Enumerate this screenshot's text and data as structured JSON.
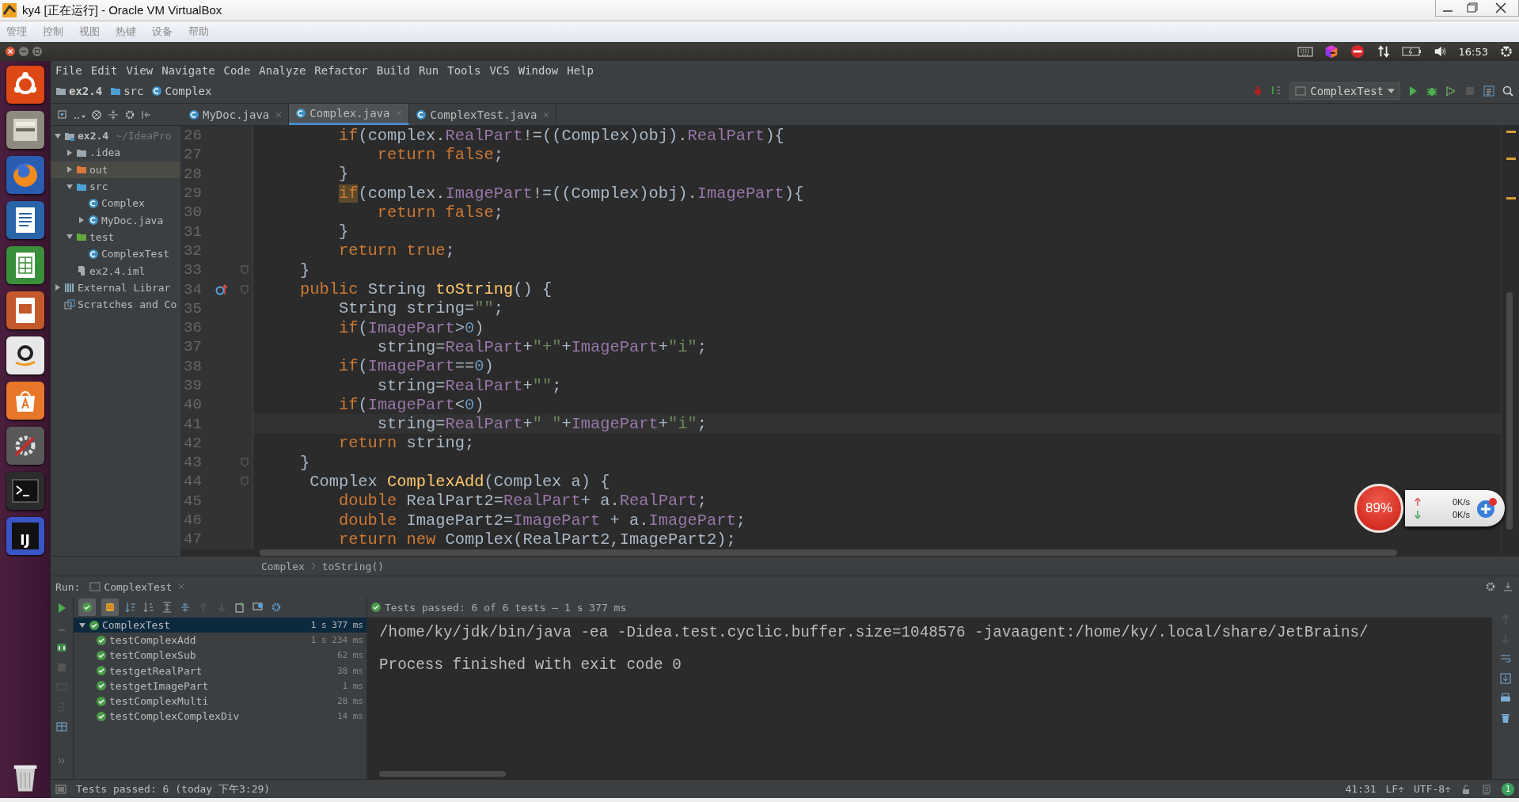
{
  "vbox": {
    "title": "ky4 [正在运行] - Oracle VM VirtualBox",
    "menu": [
      {
        "label": "管理"
      },
      {
        "label": "控制"
      },
      {
        "label": "视图"
      },
      {
        "label": "热键"
      },
      {
        "label": "设备"
      },
      {
        "label": "帮助"
      }
    ]
  },
  "panel": {
    "clock": "16:53"
  },
  "launcher": [
    {
      "kind": "ubuntu"
    },
    {
      "kind": "files"
    },
    {
      "kind": "firefox"
    },
    {
      "kind": "writer"
    },
    {
      "kind": "calc"
    },
    {
      "kind": "impress"
    },
    {
      "kind": "amazon"
    },
    {
      "kind": "store"
    },
    {
      "kind": "settings"
    },
    {
      "kind": "terminal"
    },
    {
      "kind": "idea",
      "label": "IJ"
    }
  ],
  "menu": [
    {
      "label": "File"
    },
    {
      "label": "Edit"
    },
    {
      "label": "View"
    },
    {
      "label": "Navigate"
    },
    {
      "label": "Code"
    },
    {
      "label": "Analyze"
    },
    {
      "label": "Refactor"
    },
    {
      "label": "Build"
    },
    {
      "label": "Run"
    },
    {
      "label": "Tools"
    },
    {
      "label": "VCS"
    },
    {
      "label": "Window"
    },
    {
      "label": "Help"
    }
  ],
  "navbar": [
    {
      "kind": "module",
      "label": "ex2.4"
    },
    {
      "kind": "folder",
      "label": "src"
    },
    {
      "kind": "class",
      "label": "Complex"
    }
  ],
  "run_config": "ComplexTest",
  "tabs": [
    {
      "label": "MyDoc.java",
      "selected": false
    },
    {
      "label": "Complex.java",
      "selected": true
    },
    {
      "label": "ComplexTest.java",
      "selected": false
    }
  ],
  "project_tree": [
    {
      "label": "ex2.4",
      "suffix": "~/IdeaPro",
      "kind": "module",
      "expanded": true,
      "selected": false,
      "children": [
        {
          "label": ".idea",
          "kind": "folder-grey",
          "expanded": false,
          "selected": false
        },
        {
          "label": "out",
          "kind": "folder-orange",
          "expanded": false,
          "selected": true
        },
        {
          "label": "src",
          "kind": "folder-blue",
          "expanded": true,
          "selected": false,
          "children": [
            {
              "label": "Complex",
              "kind": "class",
              "selected": false
            },
            {
              "label": "MyDoc.java",
              "kind": "class",
              "expanded": false,
              "selected": false
            }
          ]
        },
        {
          "label": "test",
          "kind": "folder-green",
          "expanded": true,
          "selected": false,
          "children": [
            {
              "label": "ComplexTest",
              "kind": "class",
              "selected": false
            }
          ]
        },
        {
          "label": "ex2.4.iml",
          "kind": "file",
          "selected": false
        }
      ]
    },
    {
      "label": "External Librar",
      "kind": "libs",
      "expanded": false,
      "selected": false
    },
    {
      "label": "Scratches and Co",
      "kind": "scratch",
      "selected": false
    }
  ],
  "code": [
    {
      "number": "26",
      "tokens": [
        {
          "kind": "kw",
          "text": "        if"
        },
        {
          "kind": "plain",
          "text": "(complex."
        },
        {
          "kind": "field",
          "text": "RealPart"
        },
        {
          "kind": "plain",
          "text": "!=((Complex)obj)."
        },
        {
          "kind": "field",
          "text": "RealPart"
        },
        {
          "kind": "plain",
          "text": "){"
        }
      ]
    },
    {
      "number": "27",
      "tokens": [
        {
          "kind": "kw",
          "text": "            return false"
        },
        {
          "kind": "plain",
          "text": ";"
        }
      ]
    },
    {
      "number": "28",
      "tokens": [
        {
          "kind": "plain",
          "text": "        }"
        }
      ]
    },
    {
      "number": "29",
      "tokens": [
        {
          "kind": "kw-match",
          "text": "        if"
        },
        {
          "kind": "plain",
          "text": "(complex."
        },
        {
          "kind": "field",
          "text": "ImagePart"
        },
        {
          "kind": "plain",
          "text": "!=((Complex)obj)."
        },
        {
          "kind": "field",
          "text": "ImagePart"
        },
        {
          "kind": "plain",
          "text": "){"
        }
      ]
    },
    {
      "number": "30",
      "tokens": [
        {
          "kind": "kw",
          "text": "            return false"
        },
        {
          "kind": "plain",
          "text": ";"
        }
      ]
    },
    {
      "number": "31",
      "tokens": [
        {
          "kind": "plain",
          "text": "        }"
        }
      ]
    },
    {
      "number": "32",
      "tokens": [
        {
          "kind": "kw",
          "text": "        return true"
        },
        {
          "kind": "plain",
          "text": ";"
        }
      ]
    },
    {
      "number": "33",
      "fold": true,
      "tokens": [
        {
          "kind": "plain",
          "text": "    }"
        }
      ]
    },
    {
      "number": "34",
      "fold": true,
      "overrides": true,
      "tokens": [
        {
          "kind": "kw",
          "text": "    public"
        },
        {
          "kind": "plain",
          "text": " String "
        },
        {
          "kind": "method",
          "text": "toString"
        },
        {
          "kind": "plain",
          "text": "() {"
        }
      ]
    },
    {
      "number": "35",
      "tokens": [
        {
          "kind": "plain",
          "text": "        String string="
        },
        {
          "kind": "str",
          "text": "\"\""
        },
        {
          "kind": "plain",
          "text": ";"
        }
      ]
    },
    {
      "number": "36",
      "tokens": [
        {
          "kind": "kw",
          "text": "        if"
        },
        {
          "kind": "plain",
          "text": "("
        },
        {
          "kind": "field",
          "text": "ImagePart"
        },
        {
          "kind": "plain",
          "text": ">"
        },
        {
          "kind": "num",
          "text": "0"
        },
        {
          "kind": "plain",
          "text": ")"
        }
      ]
    },
    {
      "number": "37",
      "tokens": [
        {
          "kind": "plain",
          "text": "            string="
        },
        {
          "kind": "field",
          "text": "RealPart"
        },
        {
          "kind": "plain",
          "text": "+"
        },
        {
          "kind": "str",
          "text": "\"+\""
        },
        {
          "kind": "plain",
          "text": "+"
        },
        {
          "kind": "field",
          "text": "ImagePart"
        },
        {
          "kind": "plain",
          "text": "+"
        },
        {
          "kind": "str",
          "text": "\"i\""
        },
        {
          "kind": "plain",
          "text": ";"
        }
      ]
    },
    {
      "number": "38",
      "tokens": [
        {
          "kind": "kw",
          "text": "        if"
        },
        {
          "kind": "plain",
          "text": "("
        },
        {
          "kind": "field",
          "text": "ImagePart"
        },
        {
          "kind": "plain",
          "text": "=="
        },
        {
          "kind": "num",
          "text": "0"
        },
        {
          "kind": "plain",
          "text": ")"
        }
      ]
    },
    {
      "number": "39",
      "tokens": [
        {
          "kind": "plain",
          "text": "            string="
        },
        {
          "kind": "field",
          "text": "RealPart"
        },
        {
          "kind": "plain",
          "text": "+"
        },
        {
          "kind": "str",
          "text": "\"\""
        },
        {
          "kind": "plain",
          "text": ";"
        }
      ]
    },
    {
      "number": "40",
      "tokens": [
        {
          "kind": "kw",
          "text": "        if"
        },
        {
          "kind": "plain",
          "text": "("
        },
        {
          "kind": "field",
          "text": "ImagePart"
        },
        {
          "kind": "plain",
          "text": "<"
        },
        {
          "kind": "num",
          "text": "0"
        },
        {
          "kind": "plain",
          "text": ")"
        }
      ]
    },
    {
      "number": "41",
      "current": true,
      "tokens": [
        {
          "kind": "plain",
          "text": "            string="
        },
        {
          "kind": "field",
          "text": "RealPart"
        },
        {
          "kind": "plain",
          "text": "+"
        },
        {
          "kind": "str",
          "text": "\" \""
        },
        {
          "kind": "plain",
          "text": "+"
        },
        {
          "kind": "field",
          "text": "ImagePart"
        },
        {
          "kind": "plain",
          "text": "+"
        },
        {
          "kind": "str",
          "text": "\"i\""
        },
        {
          "kind": "plain",
          "text": ";"
        }
      ]
    },
    {
      "number": "42",
      "tokens": [
        {
          "kind": "kw",
          "text": "        return"
        },
        {
          "kind": "plain",
          "text": " string;"
        }
      ]
    },
    {
      "number": "43",
      "fold": true,
      "tokens": [
        {
          "kind": "plain",
          "text": "    }"
        }
      ]
    },
    {
      "number": "44",
      "fold": true,
      "tokens": [
        {
          "kind": "plain",
          "text": "     Complex "
        },
        {
          "kind": "method",
          "text": "ComplexAdd"
        },
        {
          "kind": "plain",
          "text": "(Complex a) {"
        }
      ]
    },
    {
      "number": "45",
      "tokens": [
        {
          "kind": "kw",
          "text": "        double"
        },
        {
          "kind": "plain",
          "text": " RealPart2="
        },
        {
          "kind": "field",
          "text": "RealPart"
        },
        {
          "kind": "plain",
          "text": "+ a."
        },
        {
          "kind": "field",
          "text": "RealPart"
        },
        {
          "kind": "plain",
          "text": ";"
        }
      ]
    },
    {
      "number": "46",
      "tokens": [
        {
          "kind": "kw",
          "text": "        double"
        },
        {
          "kind": "plain",
          "text": " ImagePart2="
        },
        {
          "kind": "field",
          "text": "ImagePart"
        },
        {
          "kind": "plain",
          "text": " + a."
        },
        {
          "kind": "field",
          "text": "ImagePart"
        },
        {
          "kind": "plain",
          "text": ";"
        }
      ]
    },
    {
      "number": "47",
      "tokens": [
        {
          "kind": "kw",
          "text": "        return new"
        },
        {
          "kind": "plain",
          "text": " Complex(RealPart2,ImagePart2);"
        }
      ]
    }
  ],
  "breadcrumb": [
    "Complex",
    "toString()"
  ],
  "speed_widget": {
    "percent": "89%",
    "up": "0K/s",
    "down": "0K/s"
  },
  "run": {
    "label": "Run:",
    "tab": "ComplexTest",
    "summary": "Tests passed: 6 of 6 tests – 1 s 377 ms",
    "tests": [
      {
        "name": "ComplexTest",
        "time": "1 s 377 ms",
        "selected": true,
        "expanded": true,
        "children": [
          {
            "name": "testComplexAdd",
            "time": "1 s 234 ms",
            "selected": false
          },
          {
            "name": "testComplexSub",
            "time": "62 ms",
            "selected": false
          },
          {
            "name": "testgetRealPart",
            "time": "38 ms",
            "selected": false
          },
          {
            "name": "testgetImagePart",
            "time": "1 ms",
            "selected": false
          },
          {
            "name": "testComplexMulti",
            "time": "28 ms",
            "selected": false
          },
          {
            "name": "testComplexComplexDiv",
            "time": "14 ms",
            "selected": false
          }
        ]
      }
    ],
    "console": [
      "/home/ky/jdk/bin/java -ea -Didea.test.cyclic.buffer.size=1048576 -javaagent:/home/ky/.local/share/JetBrains/",
      "Process finished with exit code 0"
    ]
  },
  "status": {
    "message": "Tests passed: 6 (today 下午3:29)",
    "position": "41:31",
    "line_sep": "LF÷",
    "encoding": "UTF-8÷",
    "notifications": "1"
  }
}
